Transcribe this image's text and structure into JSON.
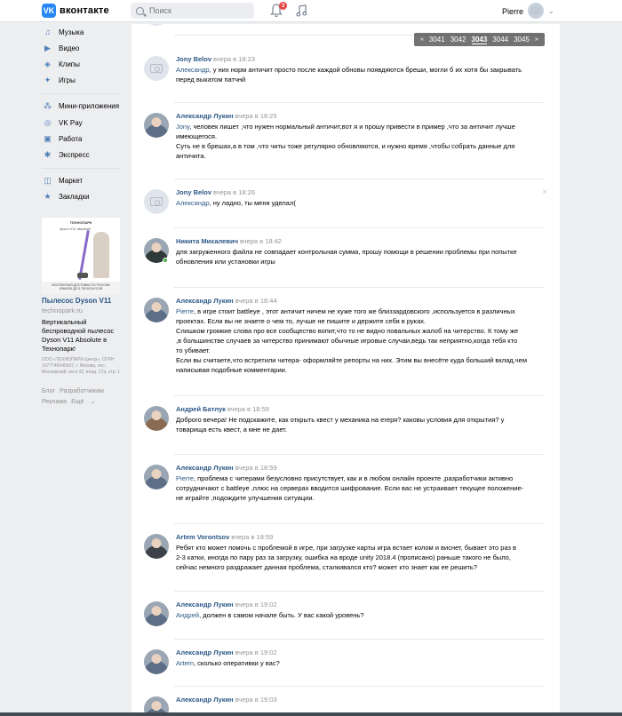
{
  "header": {
    "logo_text": "вконтакте",
    "search_placeholder": "Поиск",
    "notification_count": "3",
    "user_name": "Pierre"
  },
  "sidebar": {
    "items": [
      {
        "label": "Музыка",
        "icon": "music-icon"
      },
      {
        "label": "Видео",
        "icon": "video-icon"
      },
      {
        "label": "Клипы",
        "icon": "clips-icon"
      },
      {
        "label": "Игры",
        "icon": "games-icon"
      },
      {
        "label": "Мини-приложения",
        "icon": "apps-icon"
      },
      {
        "label": "VK Pay",
        "icon": "vkpay-icon"
      },
      {
        "label": "Работа",
        "icon": "work-icon"
      },
      {
        "label": "Экспресс",
        "icon": "express-icon"
      },
      {
        "label": "Маркет",
        "icon": "market-icon"
      },
      {
        "label": "Закладки",
        "icon": "bookmarks-icon"
      }
    ],
    "ad": {
      "brand": "ТЕХНОПАРК",
      "product_tag": "dyson V11 absolute",
      "banner_text": "БЕСПЛАТНАЯ ДОСТАВКА ПО РОССИИ\nКЭШБЭК ДО 5 750 БОНУСОВ",
      "title": "Пылесос Dyson V11",
      "domain": "technopark.ru",
      "description": "Вертикальный беспроводной пылесос Dyson V11 Absolute в Технопарк!",
      "legal": "ООО «ТЕХНОПАРК-Центр», ОГРН 1077746045607, г. Москва, пос. Московский, км-я 32, влад. 17а, стр. 1"
    },
    "footer": {
      "blog": "Блог",
      "developers": "Разработчикам",
      "ads": "Реклама",
      "more": "Ещё"
    }
  },
  "pager": {
    "prev": "«",
    "pages": [
      "3041",
      "3042",
      "3043",
      "3044",
      "3045"
    ],
    "current": "3043",
    "next": "»"
  },
  "posts": [
    {
      "author": "Jony Belov",
      "time": "вчера в 18:23",
      "mention": "Александр",
      "text": ", у них норм античит просто после каждой обновы появдяются бреши, могли б их хотя бы закрывать\nперед выкатом патчнй"
    },
    {
      "author": "Александр Лукин",
      "time": "вчера в 18:25",
      "mention": "Jony",
      "text": ", человек пишет ,что нужен нормальный античит,вот я и прошу привести в пример ,что за античит лучше\nимеющегося.\nСуть не в брешах,а в том ,что читы тоже регулярно обновляются, и нужно время ,чтобы собрать данные для\nантичита."
    },
    {
      "author": "Jony Belov",
      "time": "вчера в 18:26",
      "mention": "Александр",
      "text": ", ну ладно, ты меня уделал("
    },
    {
      "author": "Никита Михалевич",
      "time": "вчера в 18:42",
      "mention": "",
      "text": "для загруженного файла не совпадает контрольная сумма, прошу помощи в решении проблемы при попытке\nобновления или установки игры"
    },
    {
      "author": "Александр Лукин",
      "time": "вчера в 18:44",
      "mention": "Pierre",
      "text": ", в игре стоит battleye , этот античит ничем не хуже того же близзардовского ,используется в различных\nпроектах. Если вы не знаете о чем то, лучше не пишите и держите себя в руках.\nСлишком громкие слова про все сообщество вопит,что то не видно повальных жалоб на читерство. К тому же\n,в большинстве случаев за читерство принимают обычные игровые случаи,ведь так неприятно,когда тебя кто\nто убивает.\nЕсли вы считаете,что встретили читера- оформляйте репорты на них. Этим вы внесёте куда больший вклад,чем\nнаписывая подобные комментарии."
    },
    {
      "author": "Андрей Батлук",
      "time": "вчера в 18:59",
      "mention": "",
      "text": "Доброго вечера! Не подскажите, как открыть квест у механика на егеря? каковы условия для открытия? у\nтоварища есть квест, а мне не дает."
    },
    {
      "author": "Александр Лукин",
      "time": "вчера в 18:59",
      "mention": "Pierre",
      "text": ", проблема с читерами безусловно присутствует, как и в любом онлайн проекте ,разработчики активно\nсотрудничают с battleye ,плюс на серверах вводится шифрование. Если вас не устраивает текущее положение-\nне играйте ,подождите улучшения ситуации."
    },
    {
      "author": "Artem Vorontsov",
      "time": "вчера в 18:59",
      "mention": "",
      "text": "Ребят кто может помочь с проблемой в игре, при загрузке карты игра встает колом и виснет, бывает это раз в\n2-3 катки, иногда по пару раз за загрузку, ошибка на вроде unity 2018.4 (прописано) раньше такого не было,\nсейчас немного раздражает данная проблема, сталкивался кто? может кто знает как ее решить?"
    },
    {
      "author": "Александр Лукин",
      "time": "вчера в 19:02",
      "mention": "Андрей",
      "text": ", должен в самом начале быть. У вас какой уровень?"
    },
    {
      "author": "Александр Лукин",
      "time": "вчера в 19:02",
      "mention": "Artem",
      "text": ", сколько оперативки у вас?"
    },
    {
      "author": "Александр Лукин",
      "time": "вчера в 19:03",
      "mention": "",
      "text": ""
    }
  ]
}
